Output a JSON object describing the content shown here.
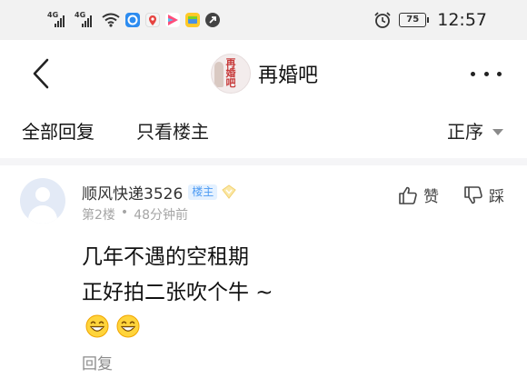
{
  "status_bar": {
    "signal_1": "4G",
    "signal_2": "4G",
    "battery": "75",
    "time": "12:57",
    "icons": [
      "wifi-icon",
      "app-icon-blue",
      "app-icon-map",
      "app-icon-video",
      "app-icon-gallery",
      "app-icon-arrow",
      "alarm-icon"
    ]
  },
  "nav": {
    "title": "再婚吧",
    "logo_text": "再婚吧",
    "back_icon": "chevron-left-icon",
    "more_icon": "more-dots-icon"
  },
  "tabs": {
    "all_replies": "全部回复",
    "owner_only": "只看楼主",
    "sort": "正序"
  },
  "reply": {
    "username": "顺风快递3526",
    "owner_badge": "楼主",
    "floor": "第2楼",
    "separator": "•",
    "time_ago": "48分钟前",
    "like_label": "赞",
    "dislike_label": "踩",
    "content_line1": "几年不遇的空租期",
    "content_line2": "正好拍二张吹个牛 ~",
    "emoji_count": 2,
    "reply_label": "回复"
  },
  "colors": {
    "badge_blue": "#4d9bf3",
    "badge_bg": "#e4f1ff",
    "meta_gray": "#a5a5a5",
    "status_bg": "#f2f2f2"
  }
}
